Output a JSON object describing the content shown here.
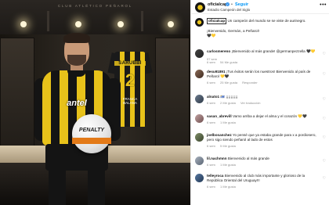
{
  "photo": {
    "ceiling_text": "CLUB ATLÉTICO PEÑAROL",
    "jersey_name": "SARUBBI",
    "jersey_number": "2",
    "jersey_note": "FRANCA BALANA",
    "shirt_sponsor": "antel",
    "ball_brand": "PENALTY"
  },
  "header": {
    "username": "oficialcap",
    "follow_label": "Seguir",
    "subtitle": "Estadio Campeón del Siglo",
    "more_icon": "more-icon"
  },
  "caption": {
    "username": "oficialcap",
    "line1": "Un campeón del mundo se se viste de aurinegro.",
    "line2": "¡Bienvenido, Germán, a Peñarol!",
    "emoji": "🖤💛",
    "meta": "57 sem"
  },
  "comments": [
    {
      "username": "carlosmereno",
      "text": "¡Bienvenido al más grande! @germanpezzella",
      "emoji": "🖤💛",
      "time": "6 sem",
      "likes": "54 Me gusta",
      "reply": ""
    },
    {
      "username": "desu91891",
      "text": "¡Tus éxitos serán los nuestros! Bienvenido al país de Peñarol",
      "emoji": "💛🖤",
      "time": "6 sem",
      "likes": "25 Me gusta",
      "reply": "Responder"
    },
    {
      "username": "alnato1",
      "text": "🇺🇾 ¡¡¡¡¡¡¡¡¡¡",
      "emoji": "",
      "time": "6 sem",
      "likes": "2 Me gusta",
      "reply": "Ver traducción"
    },
    {
      "username": "sasan_abrevill",
      "text": "Vamo arriba a dejar el alma y el corazón",
      "emoji": "💛🖤",
      "time": "6 sem",
      "likes": "1 Me gusta",
      "reply": ""
    },
    {
      "username": "joelbosanchez",
      "text": "Yo pensé que ya estaba grande para x a pordiosero, pero sigo siendo peñarol al lado de estos",
      "emoji": "",
      "time": "6 sem",
      "likes": "5 Me gusta",
      "reply": ""
    },
    {
      "username": "lil.nachmnn",
      "text": "Bienvenido al más grande",
      "emoji": "",
      "time": "6 sem",
      "likes": "1 Me gusta",
      "reply": ""
    },
    {
      "username": "telleyroca",
      "text": "Bienvenido al club más importante y glorioso de la República Oriental del Uruguay!!!",
      "emoji": "",
      "time": "6 sem",
      "likes": "1 Me gusta",
      "reply": ""
    }
  ],
  "colors": {
    "accent": "#0095f6",
    "verified": "#3897f0",
    "club_yellow": "#e8c21a",
    "club_black": "#141414"
  }
}
